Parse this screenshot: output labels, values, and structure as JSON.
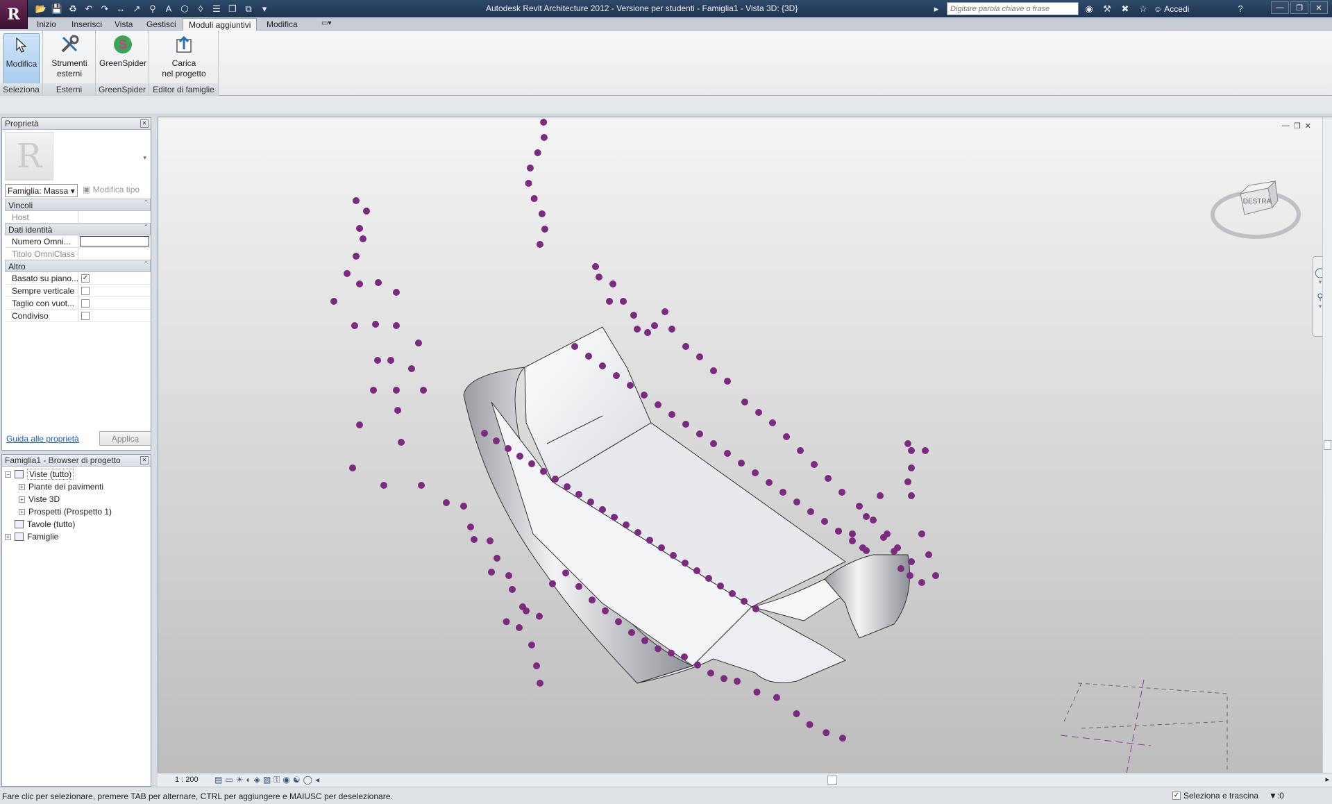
{
  "titlebar": {
    "app_letter": "R",
    "title": "Autodesk Revit Architecture 2012 - Versione per studenti -     Famiglia1 - Vista 3D: {3D}",
    "search_placeholder": "Digitare parola chiave o frase",
    "login_label": "Accedi"
  },
  "tabs": [
    "Inizio",
    "Inserisci",
    "Vista",
    "Gestisci",
    "Moduli aggiuntivi",
    "Modifica"
  ],
  "ribbon": {
    "panels": [
      {
        "title": "Seleziona",
        "buttons": [
          {
            "label": "Modifica"
          }
        ]
      },
      {
        "title": "Esterni",
        "buttons": [
          {
            "label": "Strumenti esterni"
          }
        ]
      },
      {
        "title": "GreenSpider",
        "buttons": [
          {
            "label": "GreenSpider"
          }
        ]
      },
      {
        "title": "Editor di famiglie",
        "buttons": [
          {
            "label": "Carica nel progetto"
          }
        ]
      }
    ],
    "btn_modifica": "Modifica",
    "btn_strumenti_1": "Strumenti",
    "btn_strumenti_2": "esterni",
    "btn_greenspider": "GreenSpider",
    "btn_carica_1": "Carica",
    "btn_carica_2": "nel progetto"
  },
  "properties": {
    "title": "Proprietà",
    "family_select": "Famiglia: Massa",
    "edit_type": "Modifica tipo",
    "groups": {
      "vincoli": "Vincoli",
      "dati": "Dati identità",
      "altro": "Altro"
    },
    "rows": {
      "host": "Host",
      "numero": "Numero Omni...",
      "titolo": "Titolo OmniClass",
      "basato": "Basato su piano...",
      "sempre": "Sempre verticale",
      "taglio": "Taglio con vuot...",
      "condiviso": "Condiviso"
    },
    "checked": {
      "basato": true,
      "sempre": false,
      "taglio": false,
      "condiviso": false
    },
    "help_link": "Guida alle proprietà",
    "apply": "Applica"
  },
  "browser": {
    "title": "Famiglia1 - Browser di progetto",
    "items": {
      "viste": "Viste (tutto)",
      "piante": "Piante dei pavimenti",
      "viste3d": "Viste 3D",
      "prospetti": "Prospetti (Prospetto 1)",
      "tavole": "Tavole (tutto)",
      "famiglie": "Famiglie"
    }
  },
  "viewcube_label": "DESTRA",
  "view_control": {
    "scale": "1 : 200"
  },
  "statusbar": {
    "text": "Fare clic per selezionare, premere TAB per alternare, CTRL per aggiungere e MAIUSC per deselezionare.",
    "drag_label": "Seleziona e trascina",
    "filter_count": ":0"
  },
  "colors": {
    "point": "#7b2a7f",
    "surface": "#f2f3f6"
  }
}
